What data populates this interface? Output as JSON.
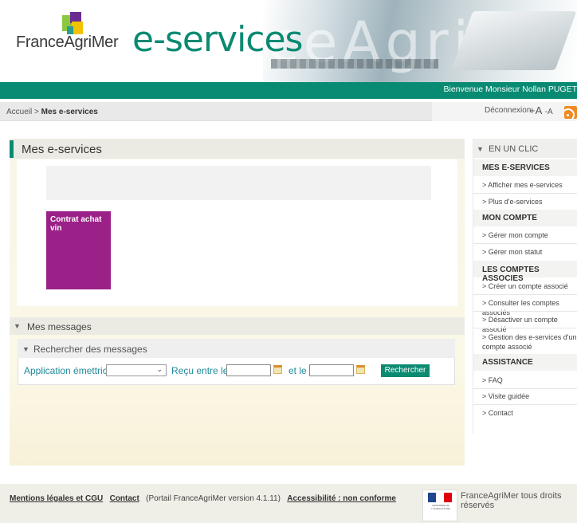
{
  "header": {
    "brand": "FranceAgriMer",
    "title": "e-services",
    "welcome": "Bienvenue Monsieur Nollan PUGET"
  },
  "nav": {
    "breadcrumb_home": "Accueil",
    "breadcrumb_sep": " > ",
    "breadcrumb_current": "Mes e-services",
    "logout": "Déconnexion",
    "font_plus": "+A",
    "font_minus": "-A"
  },
  "main": {
    "title": "Mes e-services",
    "tiles": [
      {
        "label": "Contrat achat vin",
        "color": "#9b2088"
      }
    ]
  },
  "messages": {
    "title": "Mes messages",
    "search_title": "Rechercher des messages",
    "app_label": "Application émettrice",
    "app_value": "",
    "received_label": "Reçu entre le",
    "and_label": "et le",
    "date_from": "",
    "date_to": "",
    "search_button": "Rechercher"
  },
  "sidebar": {
    "title": "EN UN CLIC",
    "sections": [
      {
        "title": "MES E-SERVICES",
        "items": [
          "> Afficher mes e-services",
          "> Plus d'e-services"
        ]
      },
      {
        "title": "MON COMPTE",
        "items": [
          "> Gérer mon compte",
          "> Gérer mon statut"
        ]
      },
      {
        "title": "LES COMPTES ASSOCIES",
        "items": [
          "> Créer un compte associé",
          "> Consulter les comptes associés",
          "> Désactiver un compte associé",
          "> Gestion des e-services d'un compte associé"
        ]
      },
      {
        "title": "ASSISTANCE",
        "items": [
          "> FAQ",
          "> Visite guidée",
          "> Contact"
        ]
      }
    ]
  },
  "footer": {
    "legal": "Mentions légales et CGU",
    "contact": "Contact",
    "version": "(Portail FranceAgriMer version 4.1.11)",
    "accessibility": "Accessibilité : non conforme",
    "rights": "FranceAgriMer tous droits réservés",
    "ministry_text": "MINISTÈRE DE L'AGRICULTURE"
  },
  "colors": {
    "brand_green": "#0b8a72",
    "tile_purple": "#9b2088",
    "label_teal": "#1e8a9b"
  }
}
